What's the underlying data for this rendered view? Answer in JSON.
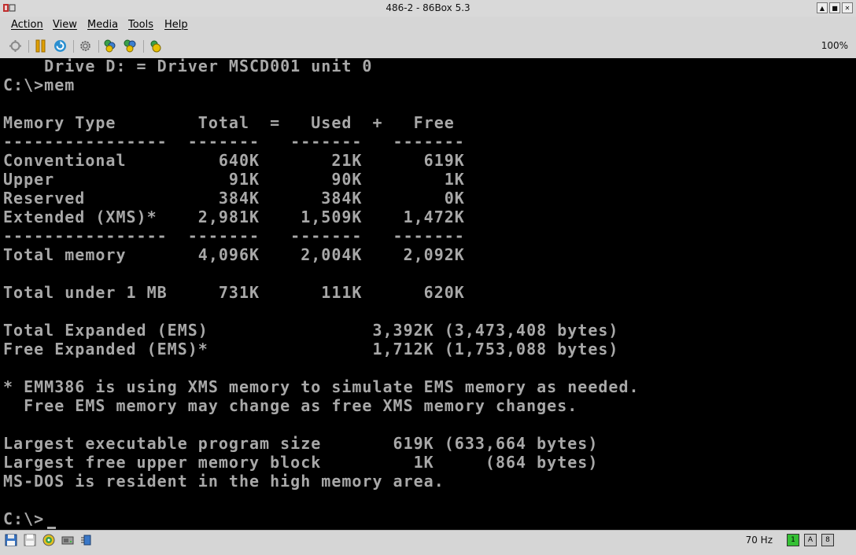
{
  "window": {
    "title": "486-2 - 86Box 5.3",
    "controls": {
      "minimize": "▲",
      "maximize": "■",
      "close": "✕"
    }
  },
  "menu": {
    "items": [
      "Action",
      "View",
      "Media",
      "Tools",
      "Help"
    ]
  },
  "toolbar": {
    "icons": [
      "power-icon",
      "pause-icon",
      "reset-icon",
      "settings-icon",
      "ctrl-alt-del-icon",
      "ctrl-alt-esc-icon",
      "screenshot-icon"
    ],
    "zoom": "100%"
  },
  "terminal": {
    "lines": [
      "    Drive D: = Driver MSCD001 unit 0",
      "C:\\>mem",
      "",
      "Memory Type        Total  =   Used  +   Free",
      "----------------  -------   -------   -------",
      "Conventional         640K       21K      619K",
      "Upper                 91K       90K        1K",
      "Reserved             384K      384K        0K",
      "Extended (XMS)*    2,981K    1,509K    1,472K",
      "----------------  -------   -------   -------",
      "Total memory       4,096K    2,004K    2,092K",
      "",
      "Total under 1 MB     731K      111K      620K",
      "",
      "Total Expanded (EMS)                3,392K (3,473,408 bytes)",
      "Free Expanded (EMS)*                1,712K (1,753,088 bytes)",
      "",
      "* EMM386 is using XMS memory to simulate EMS memory as needed.",
      "  Free EMS memory may change as free XMS memory changes.",
      "",
      "Largest executable program size       619K (633,664 bytes)",
      "Largest free upper memory block         1K     (864 bytes)",
      "MS-DOS is resident in the high memory area.",
      "",
      "C:\\>"
    ]
  },
  "statusbar": {
    "icons": [
      "floppy-icon",
      "floppy-2-icon",
      "cdrom-icon",
      "hard-disk-icon",
      "network-icon"
    ],
    "refresh_rate": "70 Hz",
    "indicators": [
      "1",
      "A",
      "8"
    ]
  },
  "colors": {
    "terminal_text": "#a8a8a8",
    "terminal_bg": "#000000",
    "chrome": "#d6d6d6"
  }
}
